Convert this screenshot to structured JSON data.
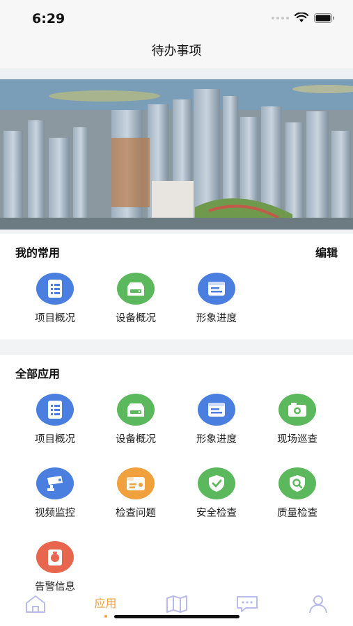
{
  "status_bar": {
    "time": "6:29"
  },
  "header": {
    "title": "待办事项"
  },
  "favorites": {
    "title": "我的常用",
    "edit_label": "编辑",
    "items": [
      {
        "label": "项目概况",
        "icon": "document-list-icon",
        "color": "#4a7fe0"
      },
      {
        "label": "设备概况",
        "icon": "device-box-icon",
        "color": "#5cb85c"
      },
      {
        "label": "形象进度",
        "icon": "progress-board-icon",
        "color": "#4a7fe0"
      }
    ]
  },
  "all_apps": {
    "title": "全部应用",
    "items": [
      {
        "label": "项目概况",
        "icon": "document-list-icon",
        "color": "#4a7fe0"
      },
      {
        "label": "设备概况",
        "icon": "device-box-icon",
        "color": "#5cb85c"
      },
      {
        "label": "形象进度",
        "icon": "progress-board-icon",
        "color": "#4a7fe0"
      },
      {
        "label": "现场巡查",
        "icon": "camera-icon",
        "color": "#5cb85c"
      },
      {
        "label": "视频监控",
        "icon": "cctv-camera-icon",
        "color": "#4a7fe0"
      },
      {
        "label": "检查问题",
        "icon": "id-card-icon",
        "color": "#f0a03c"
      },
      {
        "label": "安全检查",
        "icon": "shield-check-icon",
        "color": "#5cb85c"
      },
      {
        "label": "质量检查",
        "icon": "magnifier-doc-icon",
        "color": "#5cb85c"
      },
      {
        "label": "告警信息",
        "icon": "alarm-hand-icon",
        "color": "#e8664e"
      }
    ]
  },
  "tab_bar": {
    "active": "应用",
    "tabs": [
      {
        "icon": "home-icon"
      },
      {
        "label": "应用"
      },
      {
        "icon": "map-icon"
      },
      {
        "icon": "message-icon"
      },
      {
        "icon": "user-icon"
      }
    ],
    "colors": {
      "active": "#f0a03c",
      "inactive": "#b9bbe8"
    }
  }
}
